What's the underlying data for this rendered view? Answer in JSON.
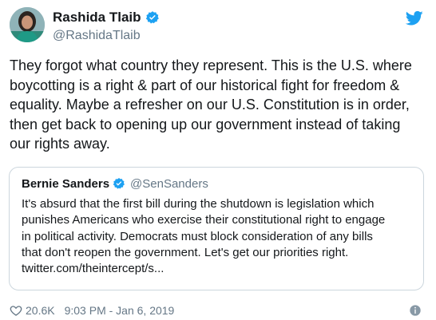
{
  "author": {
    "display_name": "Rashida Tlaib",
    "handle": "@RashidaTlaib"
  },
  "tweet_text": "They forgot what country they represent. This is the U.S. where\nboycotting is a right & part of our historical fight for freedom &\nequality. Maybe a refresher on our U.S. Constitution is in order,\nthen get back to opening up our government instead of taking\nour rights away.",
  "quoted": {
    "display_name": "Bernie Sanders",
    "handle": "@SenSanders",
    "text": "It's absurd that the first bill during the shutdown is legislation which\npunishes Americans who exercise their constitutional right to engage\nin political activity. Democrats must block consideration of any bills\nthat don't reopen the government. Let's get our priorities right.\ntwitter.com/theintercept/s..."
  },
  "footer": {
    "likes": "20.6K",
    "timestamp": "9:03 PM - Jan 6, 2019"
  },
  "icons": {
    "brand": "twitter-bird-icon",
    "verified": "verified-badge-icon",
    "like": "heart-icon",
    "info": "info-icon"
  },
  "colors": {
    "twitter_blue": "#1da1f2",
    "secondary_text": "#657786",
    "border": "#ccd6dd"
  }
}
